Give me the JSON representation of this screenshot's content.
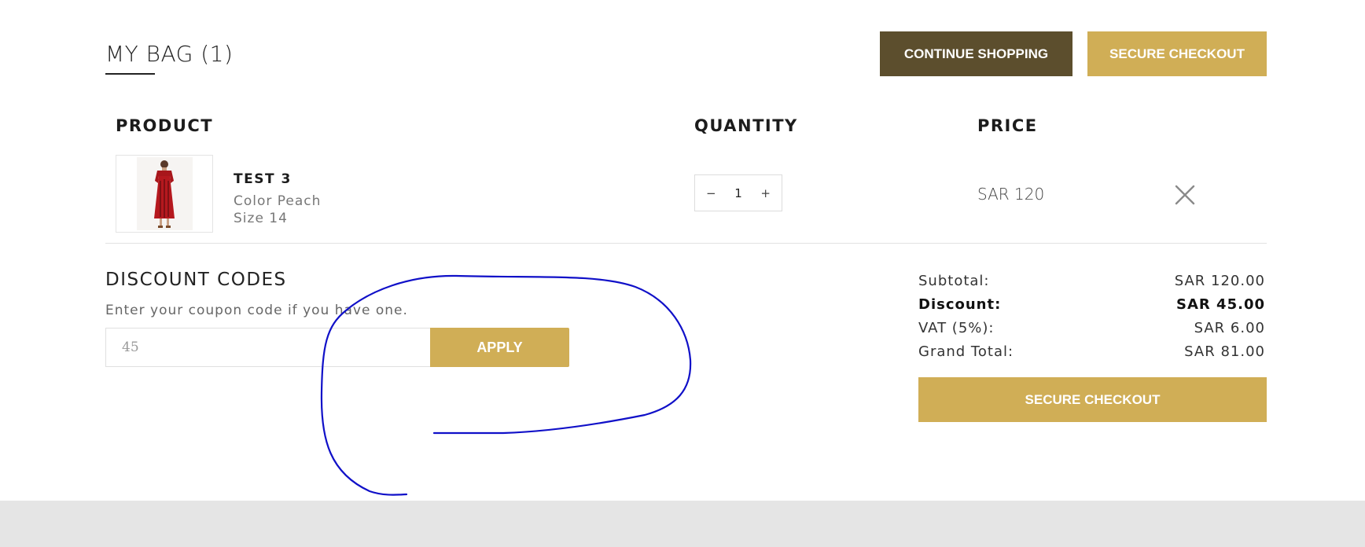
{
  "header": {
    "title": "MY BAG (1)",
    "continue_label": "CONTINUE SHOPPING",
    "checkout_label": "SECURE CHECKOUT"
  },
  "table": {
    "headers": [
      "PRODUCT",
      "QUANTITY",
      "PRICE"
    ]
  },
  "item": {
    "name": "TEST 3",
    "color": "Color Peach",
    "size": "Size 14",
    "quantity": "1",
    "minus": "−",
    "plus": "+",
    "price": "SAR 120",
    "image_icon": "red-dress-image",
    "remove_icon": "close-icon"
  },
  "discount": {
    "title": "DISCOUNT CODES",
    "description": "Enter your coupon code if you have one.",
    "input_value": "45",
    "apply_label": "APPLY"
  },
  "totals": {
    "subtotal_label": "Subtotal:",
    "subtotal_value": "SAR 120.00",
    "discount_label": "Discount:",
    "discount_value": "SAR 45.00",
    "vat_label": "VAT (5%):",
    "vat_value": "SAR 6.00",
    "grand_label": "Grand Total:",
    "grand_value": "SAR 81.00",
    "checkout_label": "SECURE CHECKOUT"
  },
  "colors": {
    "gold": "#d0ae56",
    "dark_brown": "#5c4e2d",
    "annotation_blue": "#1010c8",
    "footer_gray": "#e5e5e5"
  }
}
